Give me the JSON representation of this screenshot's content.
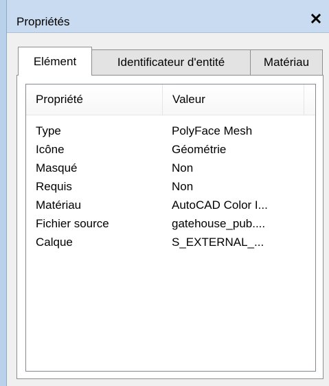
{
  "window": {
    "title": "Propriétés",
    "close_icon": "close-icon"
  },
  "tabs": [
    {
      "label": "Elément",
      "active": true
    },
    {
      "label": "Identificateur d'entité",
      "active": false
    },
    {
      "label": "Matériau",
      "active": false
    }
  ],
  "table": {
    "columns": [
      "Propriété",
      "Valeur"
    ],
    "rows": [
      {
        "property": "Type",
        "value": "PolyFace Mesh"
      },
      {
        "property": "Icône",
        "value": "Géométrie"
      },
      {
        "property": "Masqué",
        "value": "Non"
      },
      {
        "property": "Requis",
        "value": "Non"
      },
      {
        "property": "Matériau",
        "value": "AutoCAD Color I..."
      },
      {
        "property": "Fichier source",
        "value": "gatehouse_pub...."
      },
      {
        "property": "Calque",
        "value": "S_EXTERNAL_..."
      }
    ]
  }
}
